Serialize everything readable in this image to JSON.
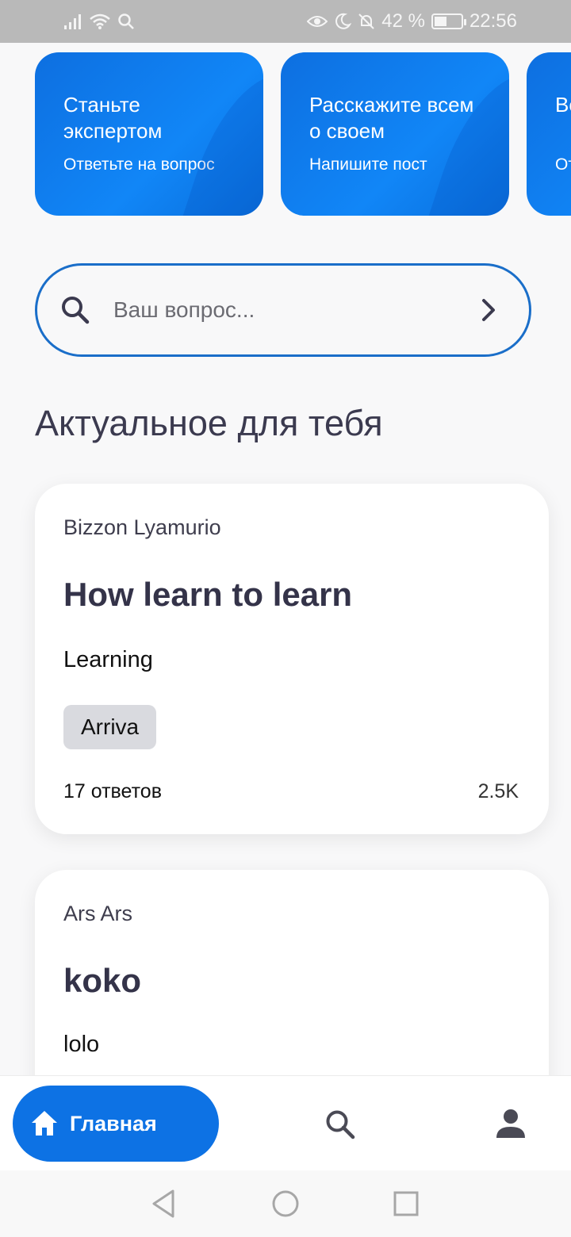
{
  "status_bar": {
    "battery_percent": "42 %",
    "time": "22:56"
  },
  "promo_cards": [
    {
      "title": "Станьте экспертом",
      "subtitle": "Ответьте на вопрос"
    },
    {
      "title": "Расскажите всем о своем",
      "subtitle": "Напишите пост"
    },
    {
      "title": "Ве ко",
      "subtitle": "От"
    }
  ],
  "search": {
    "placeholder": "Ваш вопрос..."
  },
  "section_title": "Актуальное для тебя",
  "feed": [
    {
      "author": "Bizzon Lyamurio",
      "title": "How learn to learn",
      "topic": "Learning",
      "tag": "Arriva",
      "answers": "17 ответов",
      "views": "2.5K"
    },
    {
      "author": "Ars Ars",
      "title": "koko",
      "topic": "lolo"
    }
  ],
  "bottom_nav": {
    "home_label": "Главная"
  },
  "colors": {
    "accent": "#0d72e4",
    "search_border": "#1a6ec9",
    "text_dark": "#343349"
  },
  "icons": [
    "signal-icon",
    "wifi-icon",
    "search-icon",
    "eye-icon",
    "moon-icon",
    "bell-off-icon",
    "battery-icon",
    "chevron-right-icon",
    "home-icon",
    "profile-icon",
    "back-icon",
    "home-circle-icon",
    "recents-icon"
  ]
}
